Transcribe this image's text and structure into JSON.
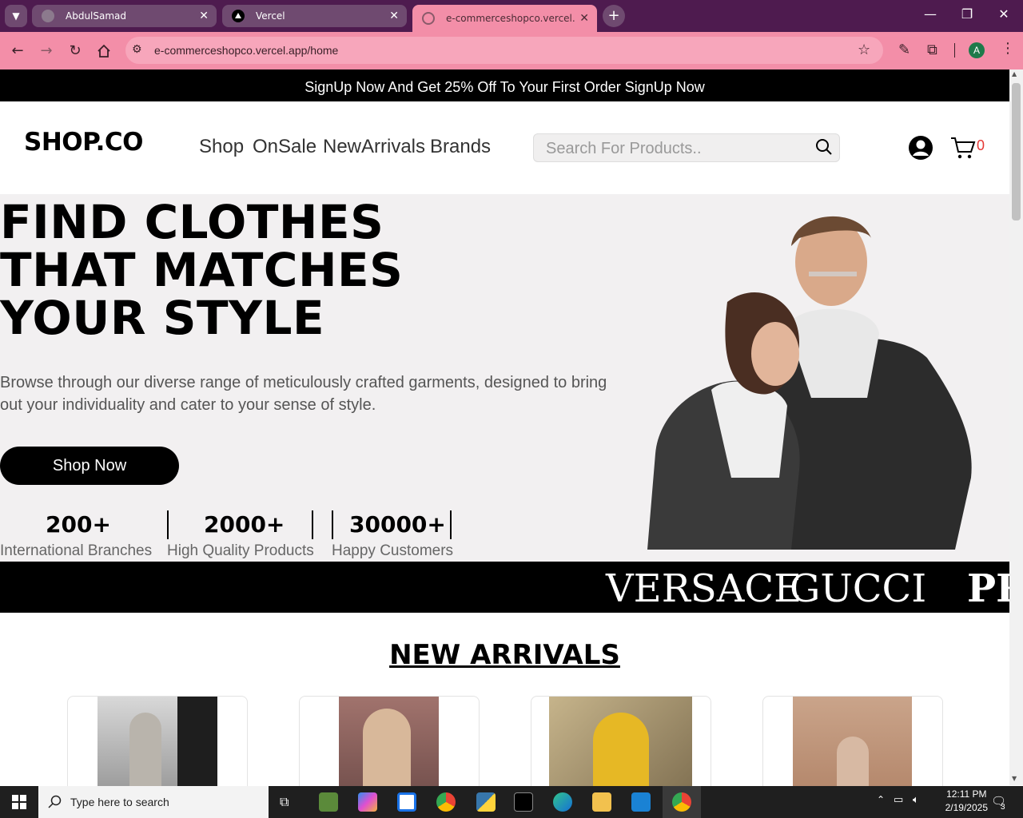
{
  "browser": {
    "tabs": [
      {
        "title": "AbdulSamad",
        "active": false
      },
      {
        "title": "Vercel",
        "active": false
      },
      {
        "title": "e-commerceshopco.vercel.app/",
        "active": true
      }
    ],
    "url": "e-commerceshopco.vercel.app/home",
    "profile_initial": "A"
  },
  "page": {
    "promo": "SignUp Now And Get 25% Off To Your First Order SignUp Now",
    "logo": "SHOP.CO",
    "nav": [
      "Shop",
      "OnSale",
      "NewArrivals",
      "Brands"
    ],
    "search_placeholder": "Search For Products..",
    "cart_count": "0",
    "hero": {
      "headline": [
        "FIND CLOTHES",
        "THAT MATCHES",
        "YOUR STYLE"
      ],
      "description": "Browse through our diverse range of meticulously crafted garments, designed to bring out your individuality and cater to your sense of style.",
      "cta": "Shop Now",
      "stats": [
        {
          "value": "200+",
          "label": "International Branches"
        },
        {
          "value": "2000+",
          "label": "High Quality Products"
        },
        {
          "value": "30000+",
          "label": "Happy Customers"
        }
      ]
    },
    "brands": [
      "VERSACE",
      "GUCCI",
      "PR"
    ],
    "section_title": "NEW ARRIVALS"
  },
  "taskbar": {
    "search_placeholder": "Type here to search",
    "time": "12:11 PM",
    "date": "2/19/2025",
    "notifications": "3"
  },
  "colors": {
    "tabbar": "#4e1b4f",
    "toolbar": "#f38ea8",
    "cart_count": "#e53935"
  }
}
